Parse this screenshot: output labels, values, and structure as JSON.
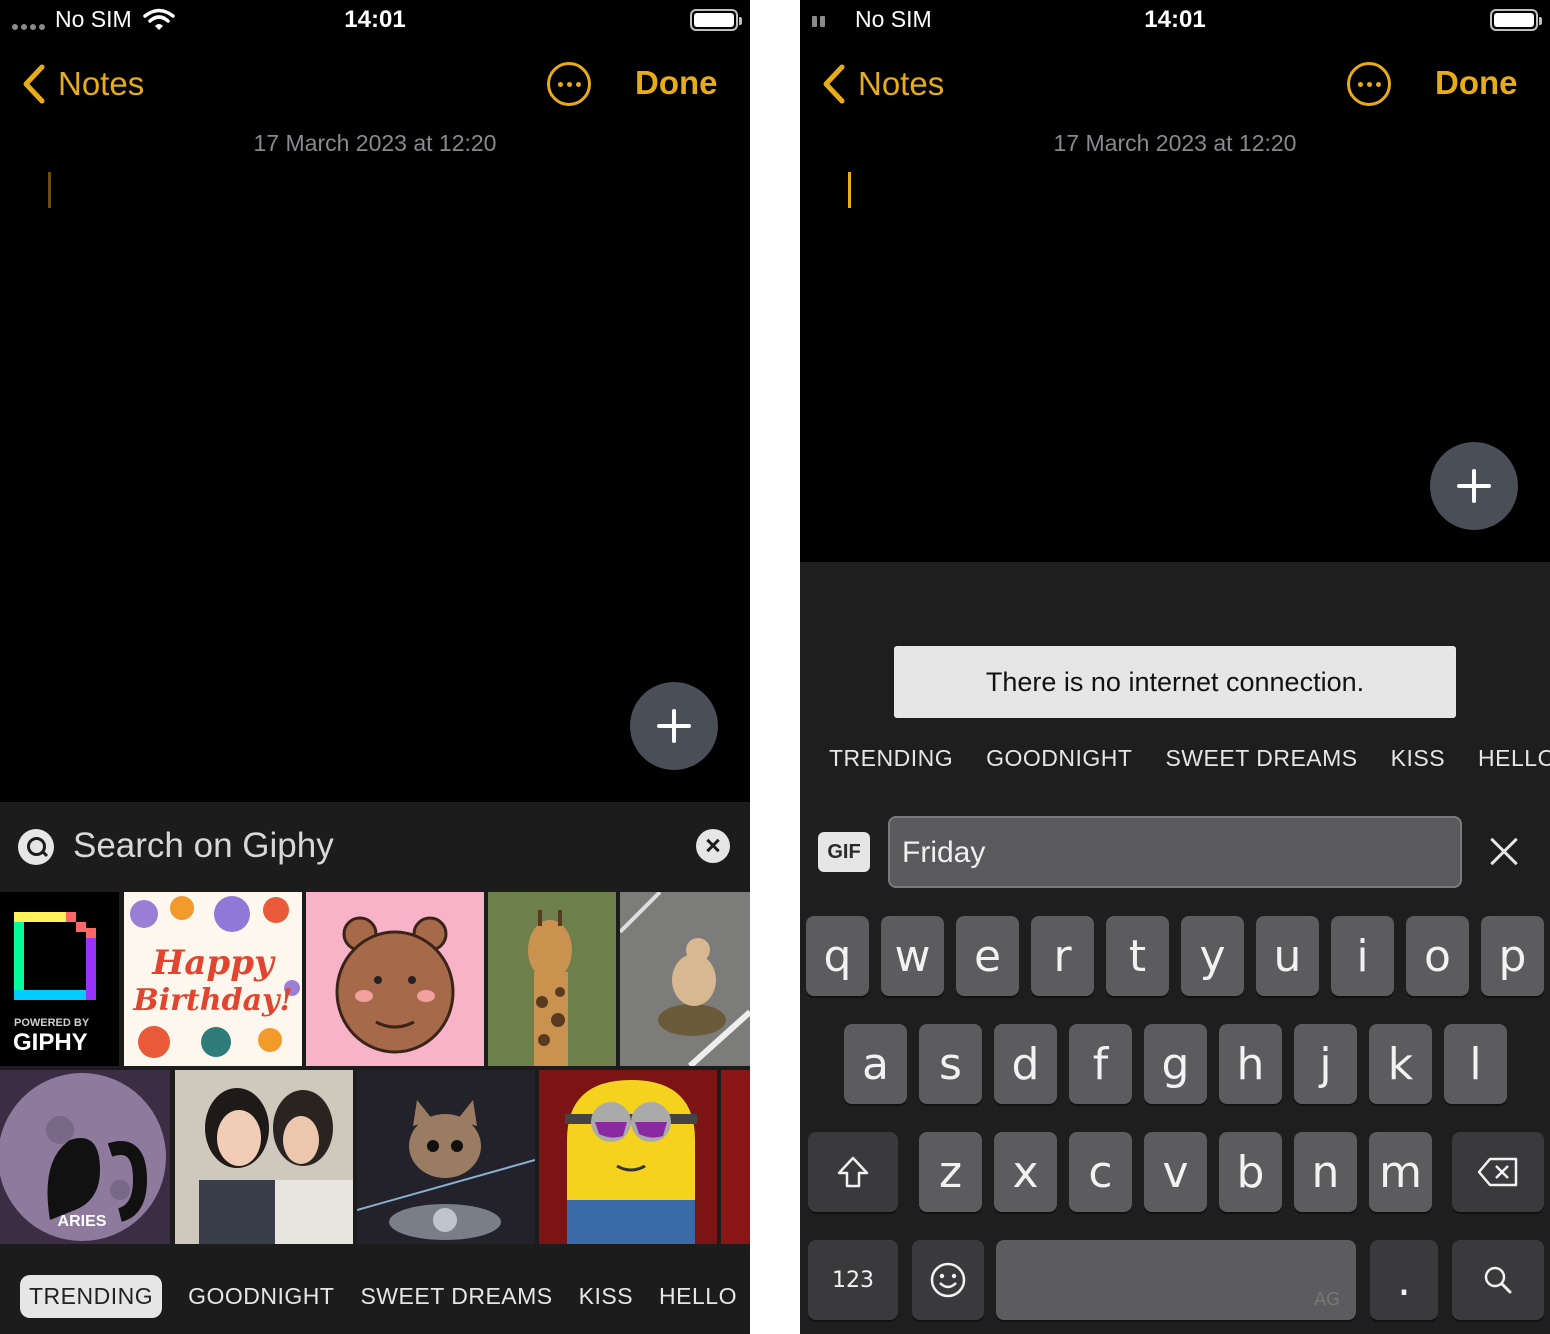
{
  "left": {
    "status": {
      "carrier": "No SIM",
      "time": "14:01"
    },
    "nav": {
      "back_label": "Notes",
      "done_label": "Done"
    },
    "note": {
      "date": "17 March 2023 at 12:20"
    },
    "giphy": {
      "search_placeholder": "Search on Giphy",
      "logo_powered": "POWERED BY",
      "logo_name": "GIPHY",
      "gifs": [
        {
          "name": "happy-birthday-gif",
          "text": "Happy Birthday!"
        },
        {
          "name": "bear-gif",
          "text": ""
        },
        {
          "name": "giraffe-gif",
          "text": ""
        },
        {
          "name": "dog-on-tortoise-gif",
          "text": ""
        },
        {
          "name": "aries-gif",
          "text": "ARIES"
        },
        {
          "name": "girls-gif",
          "text": ""
        },
        {
          "name": "cat-motorcycle-gif",
          "text": ""
        },
        {
          "name": "minion-gif",
          "text": ""
        }
      ],
      "tabs": [
        "TRENDING",
        "GOODNIGHT",
        "SWEET DREAMS",
        "KISS",
        "HELLO"
      ],
      "active_tab": "TRENDING"
    }
  },
  "right": {
    "status": {
      "carrier": "No SIM",
      "time": "14:01"
    },
    "nav": {
      "back_label": "Notes",
      "done_label": "Done"
    },
    "note": {
      "date": "17 March 2023 at 12:20"
    },
    "toast": "There is no internet connection.",
    "tabs": [
      "TRENDING",
      "GOODNIGHT",
      "SWEET DREAMS",
      "KISS",
      "HELLO"
    ],
    "gif_badge": "GIF",
    "query": "Friday",
    "keyboard": {
      "row1": [
        "q",
        "w",
        "e",
        "r",
        "t",
        "y",
        "u",
        "i",
        "o",
        "p"
      ],
      "row2": [
        "a",
        "s",
        "d",
        "f",
        "g",
        "h",
        "j",
        "k",
        "l"
      ],
      "row3": [
        "z",
        "x",
        "c",
        "v",
        "b",
        "n",
        "m"
      ],
      "numbers_label": "123",
      "period_label": ".",
      "space_watermark": "AG"
    }
  },
  "colors": {
    "accent": "#e8ac17",
    "background": "#000000",
    "panel": "#1c1c1c"
  }
}
